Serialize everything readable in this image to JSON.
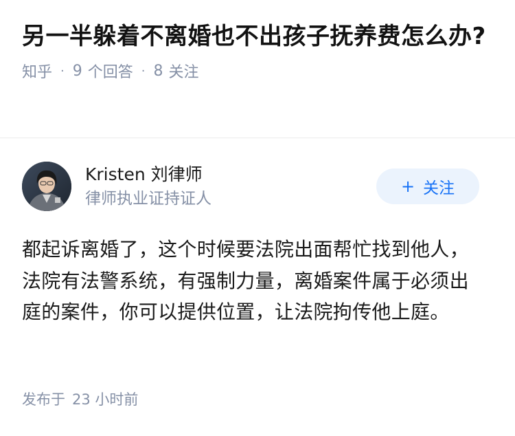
{
  "question": {
    "title": "另一半躲着不离婚也不出孩子抚养费怎么办?",
    "source": "知乎",
    "answer_count": "9",
    "answer_label": "个回答",
    "follow_count": "8",
    "follow_label": "关注"
  },
  "answer": {
    "author_name": "Kristen 刘律师",
    "author_headline": "律师执业证持证人",
    "follow_button_icon": "+",
    "follow_button_label": "关注",
    "content": "都起诉离婚了，这个时候要法院出面帮忙找到他人，法院有法警系统，有强制力量，离婚案件属于必须出庭的案件，你可以提供位置，让法院拘传他上庭。",
    "time_prefix": "发布于",
    "time_value": "23 小时前"
  },
  "colors": {
    "accent": "#1772f6",
    "button_bg": "#ebf3fd",
    "meta_text": "#8590a6"
  }
}
